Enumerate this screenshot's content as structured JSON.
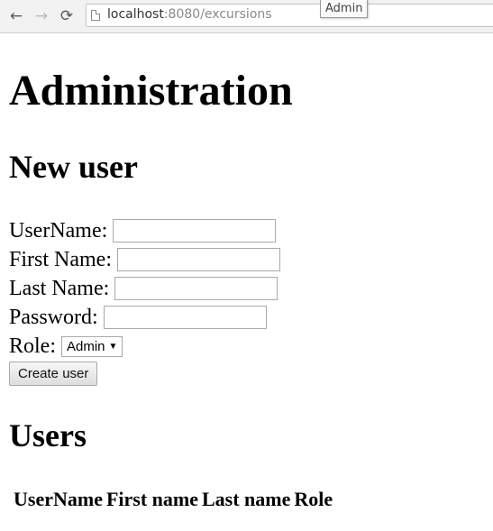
{
  "browser": {
    "back_icon": "←",
    "forward_icon": "→",
    "reload_icon": "⟳",
    "url_host": "localhost",
    "url_rest": ":8080/excursions",
    "tooltip": "Admin"
  },
  "page": {
    "title": "Administration",
    "new_user_heading": "New user",
    "users_heading": "Users"
  },
  "form": {
    "username_label": "UserName:",
    "username_value": "",
    "firstname_label": "First Name:",
    "firstname_value": "",
    "lastname_label": "Last Name:",
    "lastname_value": "",
    "password_label": "Password:",
    "password_value": "",
    "role_label": "Role:",
    "role_selected": "Admin",
    "role_caret": "▼",
    "submit_label": "Create user"
  },
  "users_table": {
    "columns": [
      "UserName",
      "First name",
      "Last name",
      "Role"
    ],
    "rows": []
  },
  "colors": {
    "toolbar_bg": "#f2f2f2",
    "page_bg": "#ffffff",
    "text": "#000000"
  }
}
